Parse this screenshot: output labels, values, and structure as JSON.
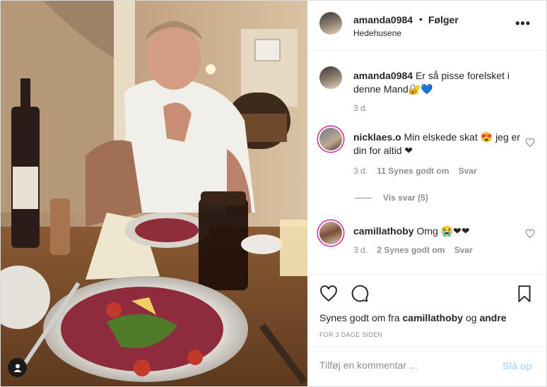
{
  "post": {
    "username": "amanda0984",
    "separator": "•",
    "follow_label": "Følger",
    "location": "Hedehusene"
  },
  "comments": [
    {
      "username": "amanda0984",
      "text": "Er så pisse forelsket i denne Mand🔐💙",
      "time": "3 d.",
      "likes": "",
      "reply": ""
    },
    {
      "username": "nicklaes.o",
      "text": "Min elskede skat 😍 jeg er din for altid ❤",
      "time": "3 d.",
      "likes": "11 Synes godt om",
      "reply": "Svar"
    },
    {
      "username": "camillathoby",
      "text": "Omg 😭❤❤",
      "time": "3 d.",
      "likes": "2 Synes godt om",
      "reply": "Svar"
    }
  ],
  "view_replies": "Vis svar (5)",
  "likes_line": {
    "prefix": "Synes godt om fra",
    "user": "camillathoby",
    "conj": "og",
    "others": "andre"
  },
  "timestamp": "FOR 3 DAGE SIDEN",
  "comment_input": {
    "placeholder": "Tilføj en kommentar ..."
  },
  "post_button": "Slå op",
  "icons": [
    "more-icon",
    "heart-icon",
    "comment-icon",
    "bookmark-icon",
    "user-tag-icon"
  ],
  "colors": {
    "link_disabled": "#b3dbff",
    "muted": "#8e8e8e",
    "text": "#262626",
    "story_ring": "#d6249f"
  }
}
